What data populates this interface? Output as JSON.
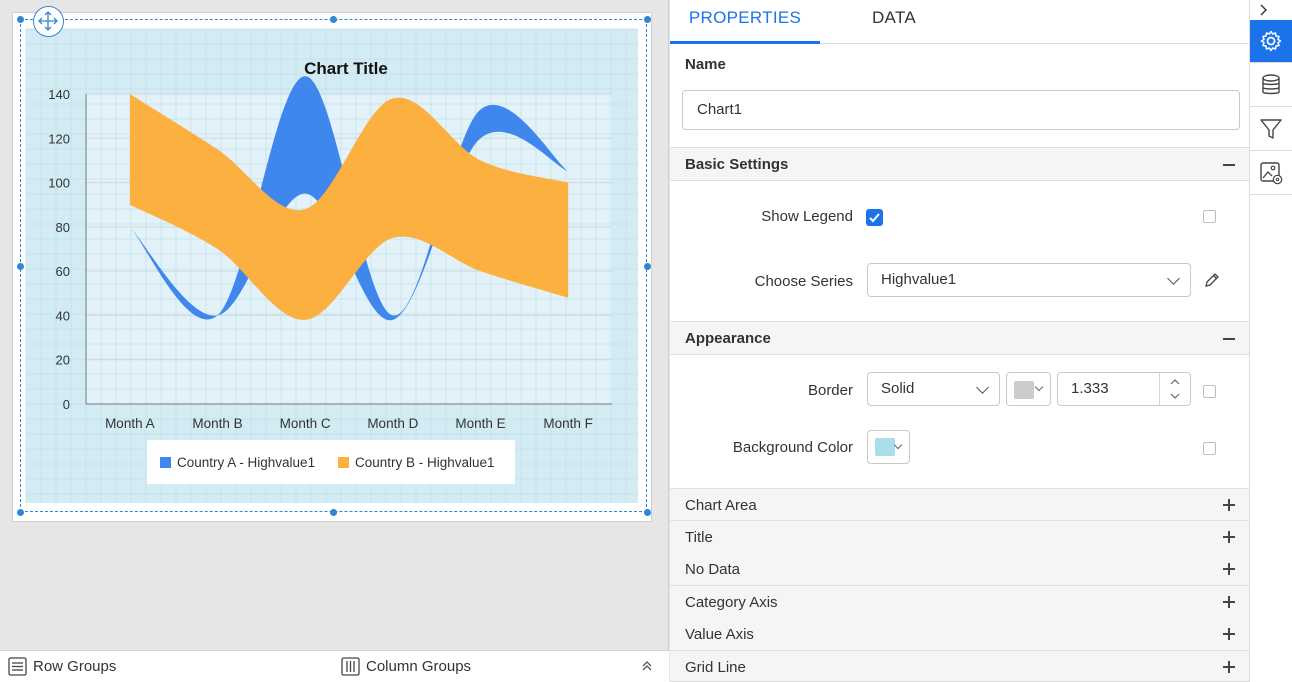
{
  "designer": {
    "groups_bar": {
      "row_groups": "Row Groups",
      "column_groups": "Column Groups"
    }
  },
  "chart_data": {
    "type": "area",
    "title": "Chart Title",
    "categories": [
      "Month A",
      "Month B",
      "Month C",
      "Month D",
      "Month E",
      "Month F"
    ],
    "ylim": [
      0,
      140
    ],
    "yticks": [
      0,
      20,
      40,
      60,
      80,
      100,
      120,
      140
    ],
    "series": [
      {
        "name": "Country A - Highvalue1",
        "color": "#3f87ec",
        "low": [
          80,
          40,
          95,
          38,
          120,
          105
        ],
        "high": [
          80,
          40,
          148,
          40,
          133,
          105
        ]
      },
      {
        "name": "Country B - Highvalue1",
        "color": "#fbb040",
        "low": [
          90,
          70,
          38,
          75,
          60,
          48
        ],
        "high": [
          140,
          115,
          88,
          138,
          110,
          100
        ]
      }
    ],
    "legend_position": "bottom",
    "plot_background": "#e2f2f8",
    "chart_background": "#d3ebf2",
    "grid": true
  },
  "properties": {
    "tabs": [
      "PROPERTIES",
      "DATA"
    ],
    "name_label": "Name",
    "name_value": "Chart1",
    "basic_settings": {
      "title": "Basic Settings",
      "show_legend_label": "Show Legend",
      "show_legend": true,
      "choose_series_label": "Choose Series",
      "choose_series_value": "Highvalue1"
    },
    "appearance": {
      "title": "Appearance",
      "border_label": "Border",
      "border_style": "Solid",
      "border_color": "#cccccc",
      "border_width": "1.333",
      "background_label": "Background Color",
      "background_color": "#a8dde9"
    },
    "collapsed_sections": [
      "Chart Area",
      "Title",
      "No Data",
      "Category Axis",
      "Value Axis",
      "Grid Line"
    ]
  },
  "sidebar": {
    "icons": [
      "settings-icon",
      "database-icon",
      "filter-icon",
      "image-settings-icon"
    ]
  }
}
